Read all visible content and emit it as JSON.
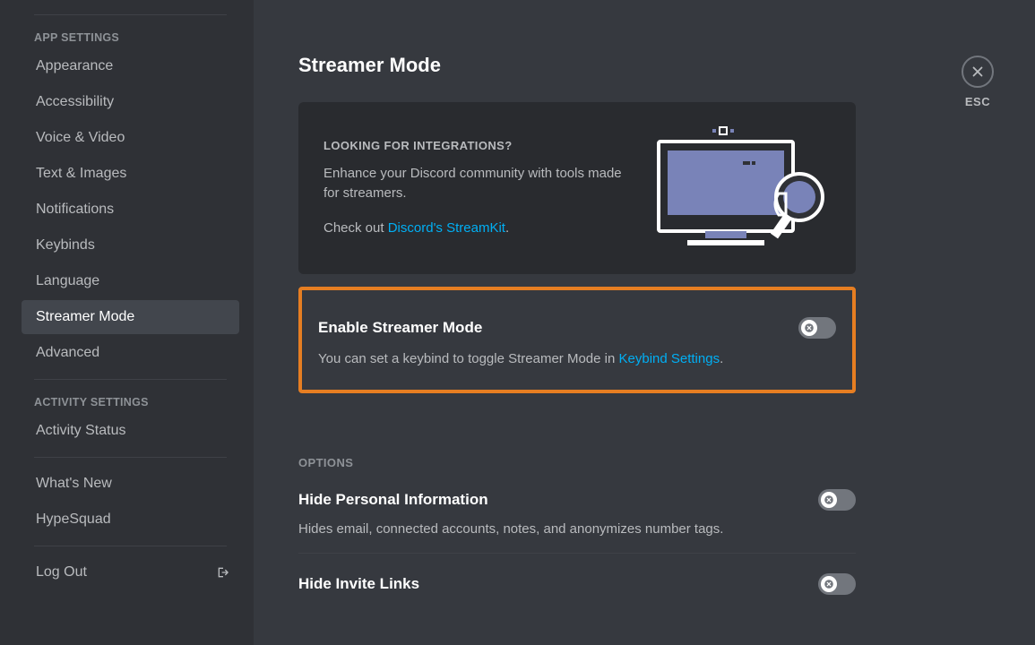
{
  "sidebar": {
    "section_app": "APP SETTINGS",
    "section_activity": "ACTIVITY SETTINGS",
    "items_app": [
      {
        "label": "Appearance"
      },
      {
        "label": "Accessibility"
      },
      {
        "label": "Voice & Video"
      },
      {
        "label": "Text & Images"
      },
      {
        "label": "Notifications"
      },
      {
        "label": "Keybinds"
      },
      {
        "label": "Language"
      },
      {
        "label": "Streamer Mode",
        "active": true
      },
      {
        "label": "Advanced"
      }
    ],
    "items_activity": [
      {
        "label": "Activity Status"
      }
    ],
    "items_misc": [
      {
        "label": "What's New"
      },
      {
        "label": "HypeSquad"
      }
    ],
    "logout": {
      "label": "Log Out"
    }
  },
  "close": {
    "esc": "ESC"
  },
  "page": {
    "title": "Streamer Mode",
    "promo": {
      "heading": "LOOKING FOR INTEGRATIONS?",
      "body": "Enhance your Discord community with tools made for streamers.",
      "checkout_prefix": "Check out ",
      "checkout_link": "Discord's StreamKit",
      "checkout_suffix": "."
    },
    "enable": {
      "title": "Enable Streamer Mode",
      "desc_prefix": "You can set a keybind to toggle Streamer Mode in ",
      "desc_link": "Keybind Settings",
      "desc_suffix": "."
    },
    "options_header": "OPTIONS",
    "options": [
      {
        "title": "Hide Personal Information",
        "desc": "Hides email, connected accounts, notes, and anonymizes number tags."
      },
      {
        "title": "Hide Invite Links",
        "desc": ""
      }
    ]
  }
}
